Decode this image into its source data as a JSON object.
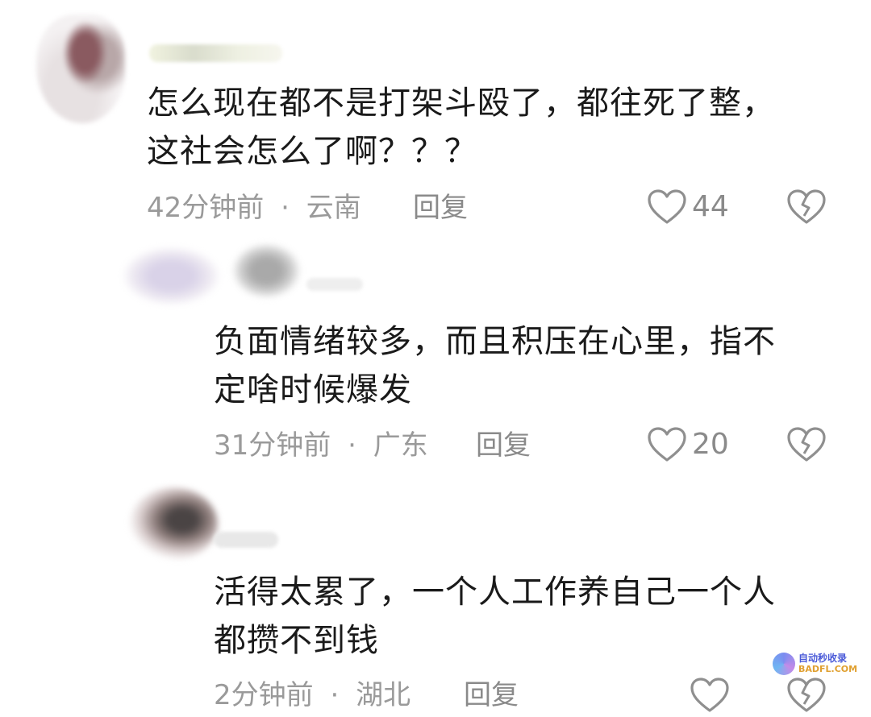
{
  "comments": [
    {
      "text_line1": "怎么现在都不是打架斗殴了，都往死了整，",
      "text_line2": "这社会怎么了啊？？？",
      "time": "42分钟前",
      "sep": "·",
      "location": "云南",
      "reply": "回复",
      "likes": "44"
    },
    {
      "text_line1": "负面情绪较多，而且积压在心里，指不",
      "text_line2": "定啥时候爆发",
      "time": "31分钟前",
      "sep": "·",
      "location": "广东",
      "reply": "回复",
      "likes": "20"
    },
    {
      "text_line1": "活得太累了，一个人工作养自己一个人",
      "text_line2": "都攒不到钱",
      "time": "2分钟前",
      "sep": "·",
      "location": "湖北",
      "reply": "回复",
      "likes": ""
    }
  ],
  "icons": {
    "like": "heart-outline-icon",
    "dislike": "broken-heart-icon"
  },
  "watermark": {
    "cn": "自动秒收录",
    "en": "BADFL.COM"
  }
}
